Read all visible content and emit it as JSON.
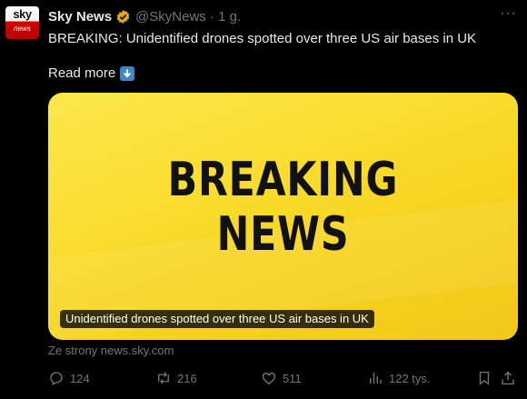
{
  "tweet": {
    "avatar_top": "sky",
    "avatar_bottom": "news",
    "author_name": "Sky News",
    "handle_time": "@SkyNews · 1 g.",
    "text": "BREAKING: Unidentified drones spotted over three US air bases in UK",
    "read_more": "Read more"
  },
  "card": {
    "headline_line1": "BREAKING",
    "headline_line2": "NEWS",
    "caption": "Unidentified drones spotted over three US air bases in UK",
    "source": "Ze strony news.sky.com"
  },
  "actions": {
    "replies": "124",
    "reposts": "216",
    "likes": "511",
    "views": "122 tys."
  },
  "colors": {
    "background": "#000000",
    "text": "#e7e9ea",
    "muted": "#71767b",
    "card_yellow": "#f9dc2d",
    "verified_gold": "#e2a812"
  }
}
